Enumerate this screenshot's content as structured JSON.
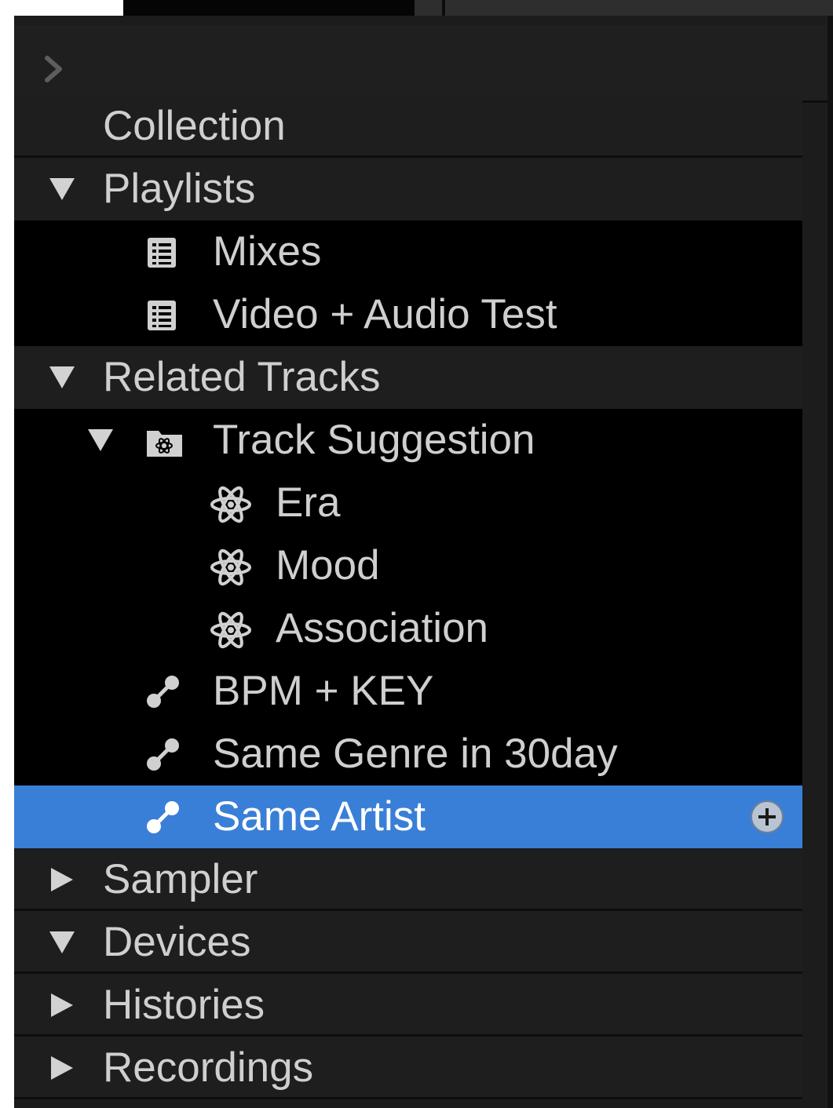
{
  "tree": {
    "collection": "Collection",
    "playlists": {
      "label": "Playlists",
      "items": [
        "Mixes",
        "Video + Audio Test"
      ]
    },
    "related_tracks": {
      "label": "Related Tracks",
      "folder": "Track Suggestion",
      "suggestions": [
        "Era",
        "Mood",
        "Association"
      ],
      "links": [
        "BPM + KEY",
        "Same Genre in 30day",
        "Same Artist"
      ]
    },
    "sampler": "Sampler",
    "devices": "Devices",
    "histories": "Histories",
    "recordings": "Recordings"
  },
  "icons": {
    "expand": "chevron-right-icon",
    "playlist": "playlist-icon",
    "folder": "intelligent-folder-icon",
    "suggestion": "atom-icon",
    "link": "link-icon",
    "add": "plus-icon"
  },
  "colors": {
    "selected": "#3a7fd7",
    "panel": "#1c1c1c",
    "child_bg": "#000000",
    "text": "#cfcfcf"
  },
  "selected_item": "Same Artist"
}
